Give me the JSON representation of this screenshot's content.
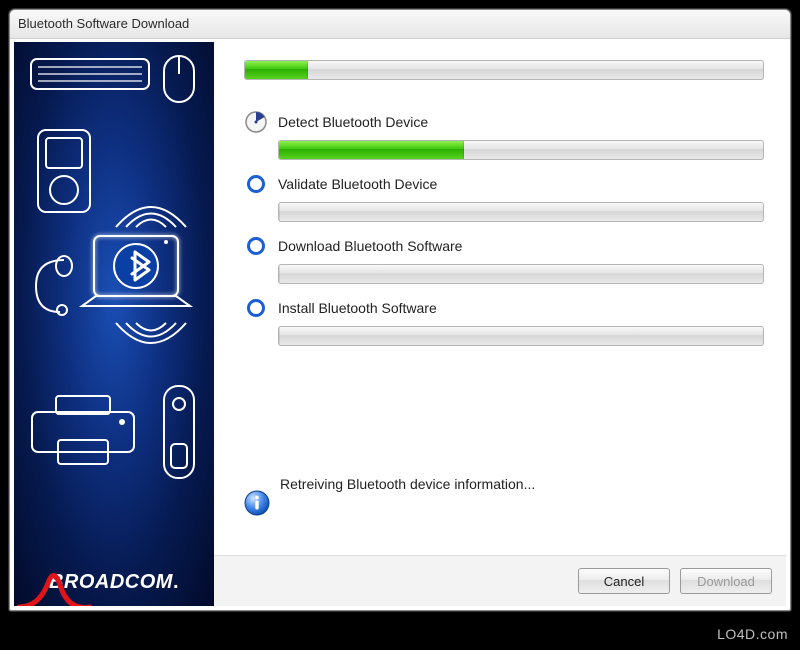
{
  "window": {
    "title": "Bluetooth Software Download"
  },
  "overall_progress": {
    "percent": 12
  },
  "steps": [
    {
      "label": "Detect Bluetooth Device",
      "progress_percent": 38,
      "state": "active"
    },
    {
      "label": "Validate Bluetooth Device",
      "progress_percent": 0,
      "state": "pending"
    },
    {
      "label": "Download Bluetooth Software",
      "progress_percent": 0,
      "state": "pending"
    },
    {
      "label": "Install Bluetooth Software",
      "progress_percent": 0,
      "state": "pending"
    }
  ],
  "status": {
    "text": "Retreiving Bluetooth device information..."
  },
  "footer": {
    "cancel_label": "Cancel",
    "download_label": "Download",
    "download_enabled": false
  },
  "brand": {
    "name": "BROADCOM",
    "suffix": "."
  },
  "watermark": "LO4D.com",
  "colors": {
    "accent_blue": "#1b5fd6",
    "progress_green": "#3cc80a",
    "sidebar_deep": "#061a50",
    "brand_red": "#e1141a"
  }
}
